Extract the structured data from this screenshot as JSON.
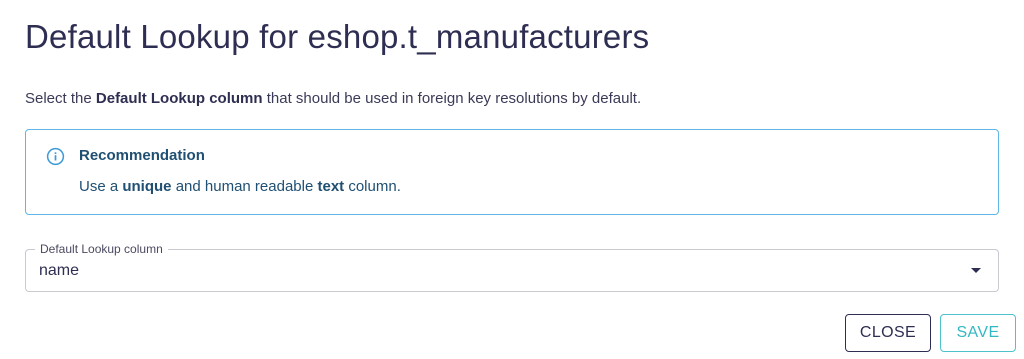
{
  "dialog": {
    "title": "Default Lookup for eshop.t_manufacturers",
    "intro": {
      "prefix": "Select the ",
      "emphasis": "Default Lookup column",
      "suffix": " that should be used in foreign key resolutions by default."
    },
    "recommendation": {
      "icon": "info-circle-icon",
      "title": "Recommendation",
      "text_prefix": "Use a ",
      "text_bold_1": "unique",
      "text_middle": " and human readable ",
      "text_bold_2": "text",
      "text_suffix": " column."
    },
    "select": {
      "label": "Default Lookup column",
      "value": "name",
      "icon": "caret-down-icon"
    },
    "actions": {
      "close_label": "CLOSE",
      "save_label": "SAVE"
    }
  },
  "colors": {
    "title": "#2e2e52",
    "info_border": "#5fb7e8",
    "info_text": "#1f4f72",
    "save_accent": "#35b7c2",
    "close_border": "#2e2e52"
  }
}
